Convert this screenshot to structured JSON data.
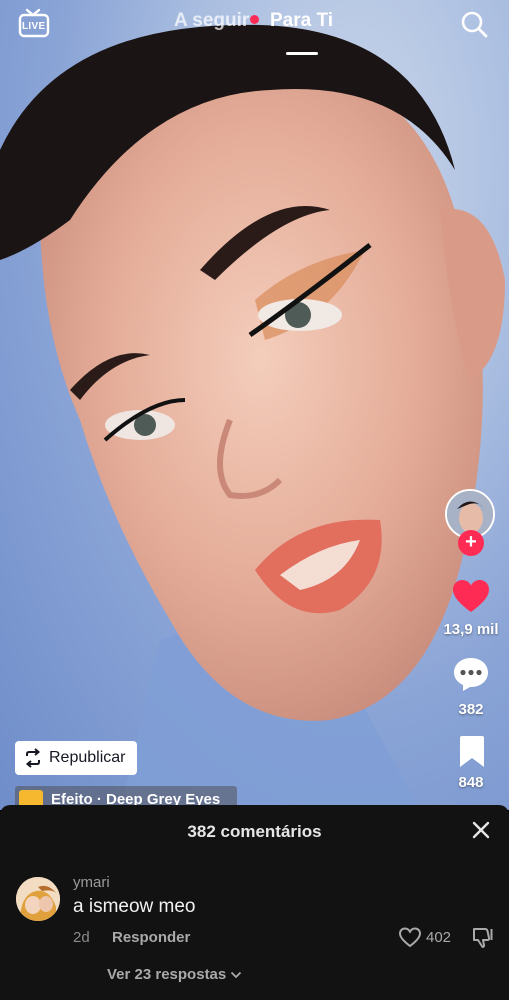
{
  "header": {
    "live_label": "LIVE",
    "tab_following": "A seguir",
    "tab_for_you": "Para Ti"
  },
  "rail": {
    "likes": "13,9 mil",
    "comments": "382",
    "saves": "848"
  },
  "video": {
    "repost_label": "Republicar",
    "effect_label": "Efeito · Deep Grey Eyes"
  },
  "comments_sheet": {
    "title": "382 comentários",
    "comment": {
      "username": "ymari",
      "text": "a ismeow meo",
      "time": "2d",
      "reply_label": "Responder",
      "likes": "402",
      "view_replies": "Ver 23 respostas"
    }
  },
  "colors": {
    "accent": "#fe2c55",
    "sheet_bg": "#121212",
    "effect_badge": "#f5b82e"
  }
}
